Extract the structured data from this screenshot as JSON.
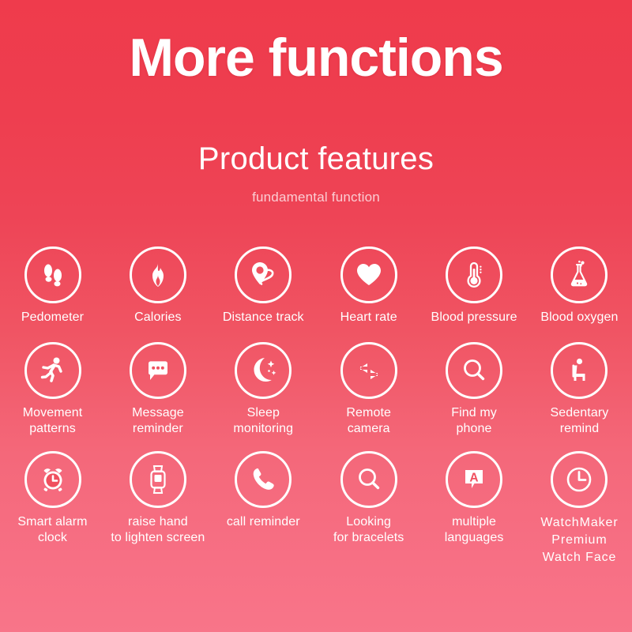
{
  "header": {
    "title": "More functions",
    "subtitle": "Product features",
    "tagline": "fundamental function"
  },
  "theme": {
    "gradient_top": "#ef3b4c",
    "gradient_bottom": "#f87589",
    "icon_color": "#ffffff",
    "text_color": "#ffffff",
    "tagline_color": "#fdd9de"
  },
  "features": {
    "rows": [
      [
        {
          "label": "Pedometer",
          "icon": "footprints-icon"
        },
        {
          "label": "Calories",
          "icon": "flame-icon"
        },
        {
          "label": "Distance track",
          "icon": "location-pin-icon"
        },
        {
          "label": "Heart rate",
          "icon": "heart-icon"
        },
        {
          "label": "Blood pressure",
          "icon": "thermometer-icon"
        },
        {
          "label": "Blood oxygen",
          "icon": "flask-icon"
        }
      ],
      [
        {
          "label": "Movement\npatterns",
          "icon": "running-person-icon"
        },
        {
          "label": "Message\nreminder",
          "icon": "chat-bubble-icon"
        },
        {
          "label": "Sleep\nmonitoring",
          "icon": "moon-stars-icon"
        },
        {
          "label": "Remote\ncamera",
          "icon": "exchange-arrows-icon"
        },
        {
          "label": "Find my\nphone",
          "icon": "magnifier-icon"
        },
        {
          "label": "Sedentary\nremind",
          "icon": "seated-person-icon"
        }
      ],
      [
        {
          "label": "Smart alarm\nclock",
          "icon": "alarm-clock-icon"
        },
        {
          "label": "raise hand\nto lighten screen",
          "icon": "smartwatch-icon"
        },
        {
          "label": "call reminder",
          "icon": "phone-handset-icon"
        },
        {
          "label": "Looking\nfor bracelets",
          "icon": "magnifier-icon"
        },
        {
          "label": "multiple\nlanguages",
          "icon": "language-bubble-icon"
        },
        {
          "label": "WatchMaker\nPremium\nWatch Face",
          "icon": "clock-icon"
        }
      ]
    ]
  }
}
